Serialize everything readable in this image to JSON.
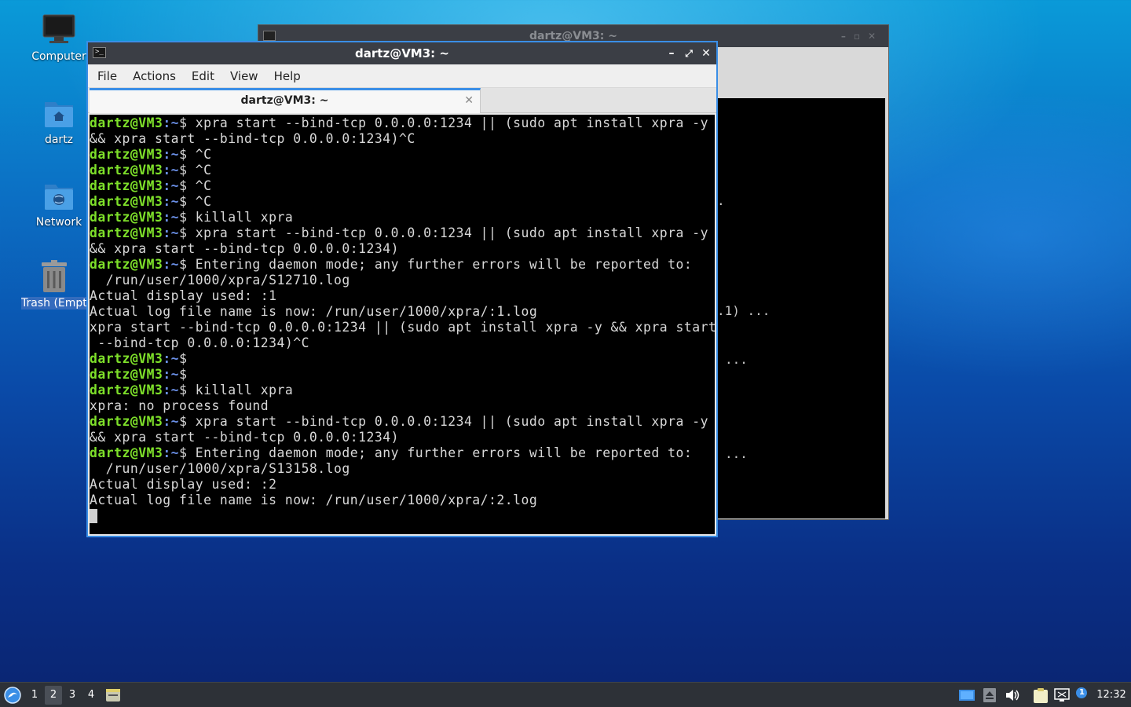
{
  "desktop": {
    "icons": [
      {
        "label": "Computer"
      },
      {
        "label": "dartz"
      },
      {
        "label": "Network"
      },
      {
        "label": "Trash (Empty)"
      }
    ]
  },
  "background_window": {
    "title": "dartz@VM3: ~",
    "fragments": [
      ".",
      ".1) ...",
      "...",
      "..."
    ]
  },
  "main_window": {
    "title": "dartz@VM3: ~",
    "menu": [
      "File",
      "Actions",
      "Edit",
      "View",
      "Help"
    ],
    "tab_title": "dartz@VM3: ~",
    "prompt_user": "dartz@VM3",
    "prompt_path": ":~",
    "prompt_sym": "$",
    "lines": [
      {
        "p": true,
        "t": " xpra start --bind-tcp 0.0.0.0:1234 || (sudo apt install xpra -y"
      },
      {
        "p": false,
        "t": "&& xpra start --bind-tcp 0.0.0.0:1234)^C"
      },
      {
        "p": true,
        "t": " ^C"
      },
      {
        "p": true,
        "t": " ^C"
      },
      {
        "p": true,
        "t": " ^C"
      },
      {
        "p": true,
        "t": " ^C"
      },
      {
        "p": true,
        "t": " killall xpra"
      },
      {
        "p": true,
        "t": " xpra start --bind-tcp 0.0.0.0:1234 || (sudo apt install xpra -y"
      },
      {
        "p": false,
        "t": "&& xpra start --bind-tcp 0.0.0.0:1234)"
      },
      {
        "p": true,
        "t": " Entering daemon mode; any further errors will be reported to:"
      },
      {
        "p": false,
        "t": "  /run/user/1000/xpra/S12710.log"
      },
      {
        "p": false,
        "t": "Actual display used: :1"
      },
      {
        "p": false,
        "t": "Actual log file name is now: /run/user/1000/xpra/:1.log"
      },
      {
        "p": false,
        "t": "xpra start --bind-tcp 0.0.0.0:1234 || (sudo apt install xpra -y && xpra start"
      },
      {
        "p": false,
        "t": " --bind-tcp 0.0.0.0:1234)^C"
      },
      {
        "p": true,
        "t": ""
      },
      {
        "p": true,
        "t": ""
      },
      {
        "p": true,
        "t": " killall xpra"
      },
      {
        "p": false,
        "t": "xpra: no process found"
      },
      {
        "p": true,
        "t": " xpra start --bind-tcp 0.0.0.0:1234 || (sudo apt install xpra -y"
      },
      {
        "p": false,
        "t": "&& xpra start --bind-tcp 0.0.0.0:1234)"
      },
      {
        "p": true,
        "t": " Entering daemon mode; any further errors will be reported to:"
      },
      {
        "p": false,
        "t": "  /run/user/1000/xpra/S13158.log"
      },
      {
        "p": false,
        "t": "Actual display used: :2"
      },
      {
        "p": false,
        "t": "Actual log file name is now: /run/user/1000/xpra/:2.log"
      }
    ]
  },
  "taskbar": {
    "workspaces": [
      "1",
      "2",
      "3",
      "4"
    ],
    "active_workspace": "2",
    "clock": "12:32",
    "notification_count": "1"
  },
  "colors": {
    "prompt_green": "#7ee02a",
    "prompt_blue": "#6a8fe6",
    "accent": "#3a8ee6",
    "titlebar": "#3b3e45"
  }
}
